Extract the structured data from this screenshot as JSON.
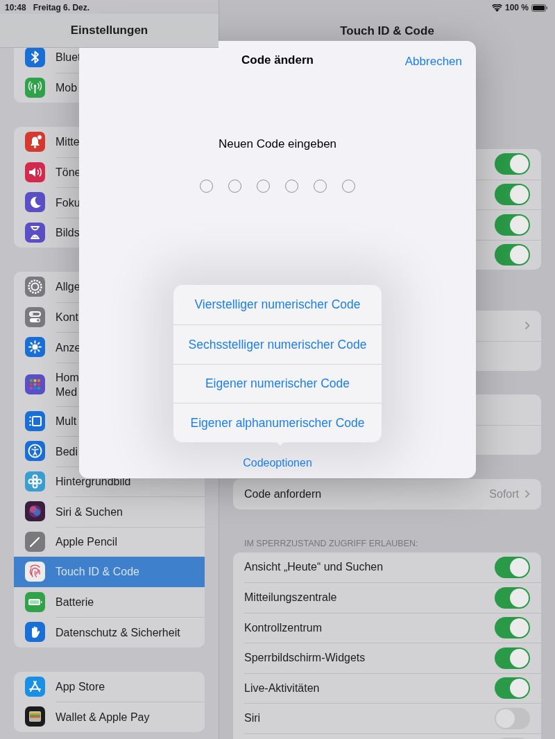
{
  "status_bar": {
    "time": "10:48",
    "date": "Freitag 6. Dez.",
    "battery": "100 %"
  },
  "sidebar": {
    "title": "Einstellungen",
    "groups": [
      {
        "items": [
          {
            "label": "Bluet",
            "color": "#1a6fd6",
            "selected": false
          },
          {
            "label": "Mob",
            "color": "#2fa24a",
            "selected": false
          }
        ]
      },
      {
        "items": [
          {
            "label": "Mitte",
            "color": "#d43a2f",
            "selected": false
          },
          {
            "label": "Töne",
            "color": "#d42a4d",
            "selected": false
          },
          {
            "label": "Foku",
            "color": "#5a4fc4",
            "selected": false
          },
          {
            "label": "Bilds",
            "color": "#5a4fc4",
            "selected": false
          }
        ]
      },
      {
        "items": [
          {
            "label": "Allge",
            "color": "#7a7a7e",
            "selected": false
          },
          {
            "label": "Kont",
            "color": "#7a7a7e",
            "selected": false
          },
          {
            "label": "Anze",
            "color": "#1a6fd6",
            "selected": false
          },
          {
            "label": "Hom\nMed",
            "color": "#5a4fc4",
            "selected": false
          },
          {
            "label": "Mult",
            "color": "#1a6fd6",
            "selected": false
          },
          {
            "label": "Bedi",
            "color": "#1a6fd6",
            "selected": false
          },
          {
            "label": "Hintergrundbild",
            "color": "#3a9fd0",
            "selected": false
          },
          {
            "label": "Siri & Suchen",
            "color": "#3a1e3e",
            "selected": false
          },
          {
            "label": "Apple Pencil",
            "color": "#7a7a7e",
            "selected": false
          },
          {
            "label": "Touch ID & Code",
            "color": "#ececec",
            "selected": true
          },
          {
            "label": "Batterie",
            "color": "#2fa24a",
            "selected": false
          },
          {
            "label": "Datenschutz & Sicherheit",
            "color": "#1a6fd6",
            "selected": false
          }
        ]
      },
      {
        "items": [
          {
            "label": "App Store",
            "color": "#1a8fe6",
            "selected": false
          },
          {
            "label": "Wallet & Apple Pay",
            "color": "#1c1c1e",
            "selected": false
          }
        ]
      }
    ]
  },
  "detail": {
    "title": "Touch ID & Code",
    "groups": [
      {
        "rows": [
          {
            "kind": "toggle",
            "on": true
          },
          {
            "kind": "toggle",
            "on": true
          },
          {
            "kind": "toggle",
            "on": true
          },
          {
            "kind": "toggle",
            "on": true
          }
        ]
      },
      {
        "rows": [
          {
            "kind": "link"
          },
          {
            "kind": "blank"
          }
        ]
      },
      {
        "rows": [
          {
            "kind": "blank"
          },
          {
            "kind": "blank"
          }
        ]
      },
      {
        "rows": [
          {
            "kind": "value",
            "label": "Code anfordern",
            "value": "Sofort"
          }
        ]
      },
      {
        "header": "IM SPERRZUSTAND ZUGRIFF ERLAUBEN:",
        "rows": [
          {
            "kind": "toggle",
            "label": "Ansicht „Heute“ und Suchen",
            "on": true
          },
          {
            "kind": "toggle",
            "label": "Mitteilungszentrale",
            "on": true
          },
          {
            "kind": "toggle",
            "label": "Kontrollzentrum",
            "on": true
          },
          {
            "kind": "toggle",
            "label": "Sperrbildschirm-Widgets",
            "on": true
          },
          {
            "kind": "toggle",
            "label": "Live-Aktivitäten",
            "on": true
          },
          {
            "kind": "toggle",
            "label": "Siri",
            "on": false
          },
          {
            "kind": "toggle",
            "on": false
          }
        ]
      }
    ]
  },
  "dialog": {
    "title": "Code ändern",
    "cancel": "Abbrechen",
    "prompt": "Neuen Code eingeben",
    "digits": [
      {
        "filled": false
      },
      {
        "filled": false
      },
      {
        "filled": false
      },
      {
        "filled": false
      },
      {
        "filled": false
      },
      {
        "filled": false
      }
    ],
    "options": [
      "Vierstelliger numerischer Code",
      "Sechsstelliger numerischer Code",
      "Eigener numerischer Code",
      "Eigener alphanumerischer Code"
    ],
    "options_button": "Codeoptionen"
  }
}
